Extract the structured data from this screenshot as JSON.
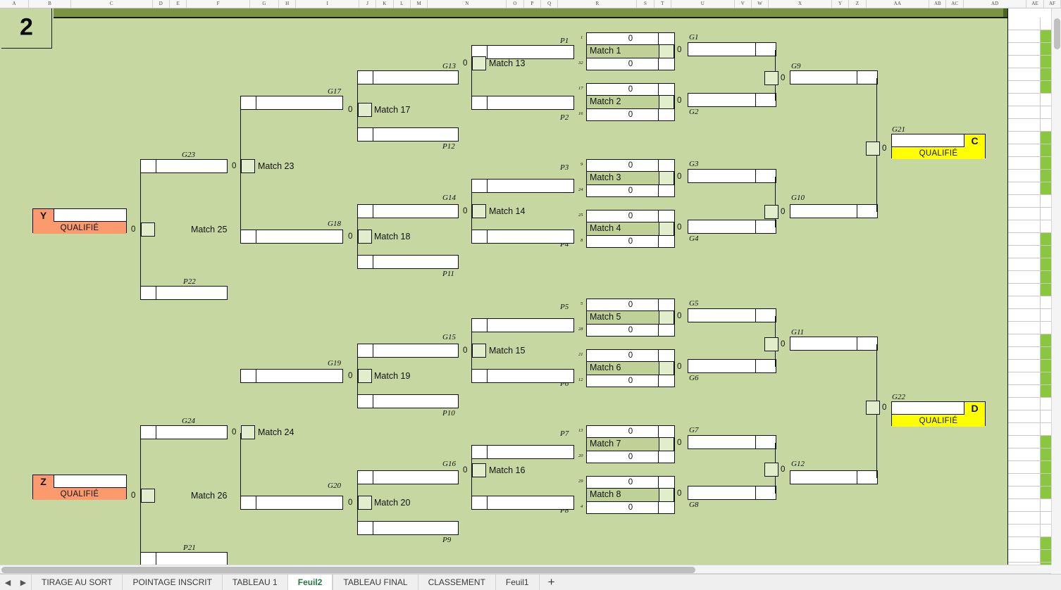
{
  "columns": [
    "A",
    "B",
    "C",
    "D",
    "E",
    "F",
    "G",
    "H",
    "I",
    "J",
    "K",
    "L",
    "M",
    "N",
    "O",
    "P",
    "Q",
    "R",
    "S",
    "T",
    "U",
    "V",
    "W",
    "X",
    "Y",
    "Z",
    "AA",
    "AB",
    "AC",
    "AD",
    "AE",
    "AF"
  ],
  "corner_cell": {
    "value": "2"
  },
  "qualified_label": "QUALIFIÉ",
  "zero": "0",
  "qualifiers": {
    "left": [
      {
        "letter": "Y",
        "status": "QUALIFIÉ"
      },
      {
        "letter": "Z",
        "status": "QUALIFIÉ"
      }
    ],
    "right": [
      {
        "letter": "C",
        "status": "QUALIFIÉ",
        "label": "G21"
      },
      {
        "letter": "D",
        "status": "QUALIFIÉ",
        "label": "G22"
      }
    ]
  },
  "matches": [
    {
      "name": "Match 1",
      "top_seed": "1",
      "bottom_seed": "32",
      "top_score": "0",
      "bottom_score": "0",
      "score": "0"
    },
    {
      "name": "Match 2",
      "top_seed": "17",
      "bottom_seed": "16",
      "top_score": "0",
      "bottom_score": "0",
      "score": "0"
    },
    {
      "name": "Match 3",
      "top_seed": "9",
      "bottom_seed": "24",
      "top_score": "0",
      "bottom_score": "0",
      "score": "0"
    },
    {
      "name": "Match 4",
      "top_seed": "25",
      "bottom_seed": "8",
      "top_score": "0",
      "bottom_score": "0",
      "score": "0"
    },
    {
      "name": "Match 5",
      "top_seed": "5",
      "bottom_seed": "28",
      "top_score": "0",
      "bottom_score": "0",
      "score": "0"
    },
    {
      "name": "Match 6",
      "top_seed": "21",
      "bottom_seed": "12",
      "top_score": "0",
      "bottom_score": "0",
      "score": "0"
    },
    {
      "name": "Match 7",
      "top_seed": "13",
      "bottom_seed": "20",
      "top_score": "0",
      "bottom_score": "0",
      "score": "0"
    },
    {
      "name": "Match 8",
      "top_seed": "29",
      "bottom_seed": "4",
      "top_score": "0",
      "bottom_score": "0",
      "score": "0"
    }
  ],
  "loser_matches": [
    {
      "name": "Match 13",
      "score": "0"
    },
    {
      "name": "Match 14",
      "score": "0"
    },
    {
      "name": "Match 15",
      "score": "0"
    },
    {
      "name": "Match 16",
      "score": "0"
    },
    {
      "name": "Match 17",
      "score": "0"
    },
    {
      "name": "Match 18",
      "score": "0"
    },
    {
      "name": "Match 19",
      "score": "0"
    },
    {
      "name": "Match 20",
      "score": "0"
    },
    {
      "name": "Match 23",
      "score": "0"
    },
    {
      "name": "Match 24",
      "score": "0"
    },
    {
      "name": "Match 25",
      "score": "0"
    },
    {
      "name": "Match 26",
      "score": "0"
    }
  ],
  "slot_labels": {
    "p1": "P1",
    "p2": "P2",
    "p3": "P3",
    "p4": "P4",
    "p5": "P5",
    "p6": "P6",
    "p7": "P7",
    "p8": "P8",
    "p9": "P9",
    "p10": "P10",
    "p11": "P11",
    "p12": "P12",
    "p21": "P21",
    "p22": "P22",
    "g1": "G1",
    "g2": "G2",
    "g3": "G3",
    "g4": "G4",
    "g5": "G5",
    "g6": "G6",
    "g7": "G7",
    "g8": "G8",
    "g9": "G9",
    "g10": "G10",
    "g11": "G11",
    "g12": "G12",
    "g13": "G13",
    "g14": "G14",
    "g15": "G15",
    "g16": "G16",
    "g17": "G17",
    "g18": "G18",
    "g19": "G19",
    "g20": "G20",
    "g21": "G21",
    "g22": "G22",
    "g23": "G23",
    "g24": "G24"
  },
  "sheet_tabs": [
    {
      "label": "TIRAGE AU SORT",
      "active": false
    },
    {
      "label": "POINTAGE INSCRIT",
      "active": false
    },
    {
      "label": "TABLEAU 1",
      "active": false
    },
    {
      "label": "Feuil2",
      "active": true
    },
    {
      "label": "TABLEAU FINAL",
      "active": false
    },
    {
      "label": "CLASSEMENT",
      "active": false
    },
    {
      "label": "Feuil1",
      "active": false
    }
  ],
  "add_sheet_icon": "+",
  "nav": {
    "prev": "◀",
    "next": "▶"
  },
  "colors": {
    "sheet_bg": "#c7d7a1",
    "band": "#7c9244",
    "match_band": "#c0d198",
    "winner_cell": "#e2eecb",
    "orange": "#fb9a6c",
    "yellow": "#ffff00",
    "flag_green": "#8cc63f",
    "active_tab_text": "#1f7a3d"
  }
}
